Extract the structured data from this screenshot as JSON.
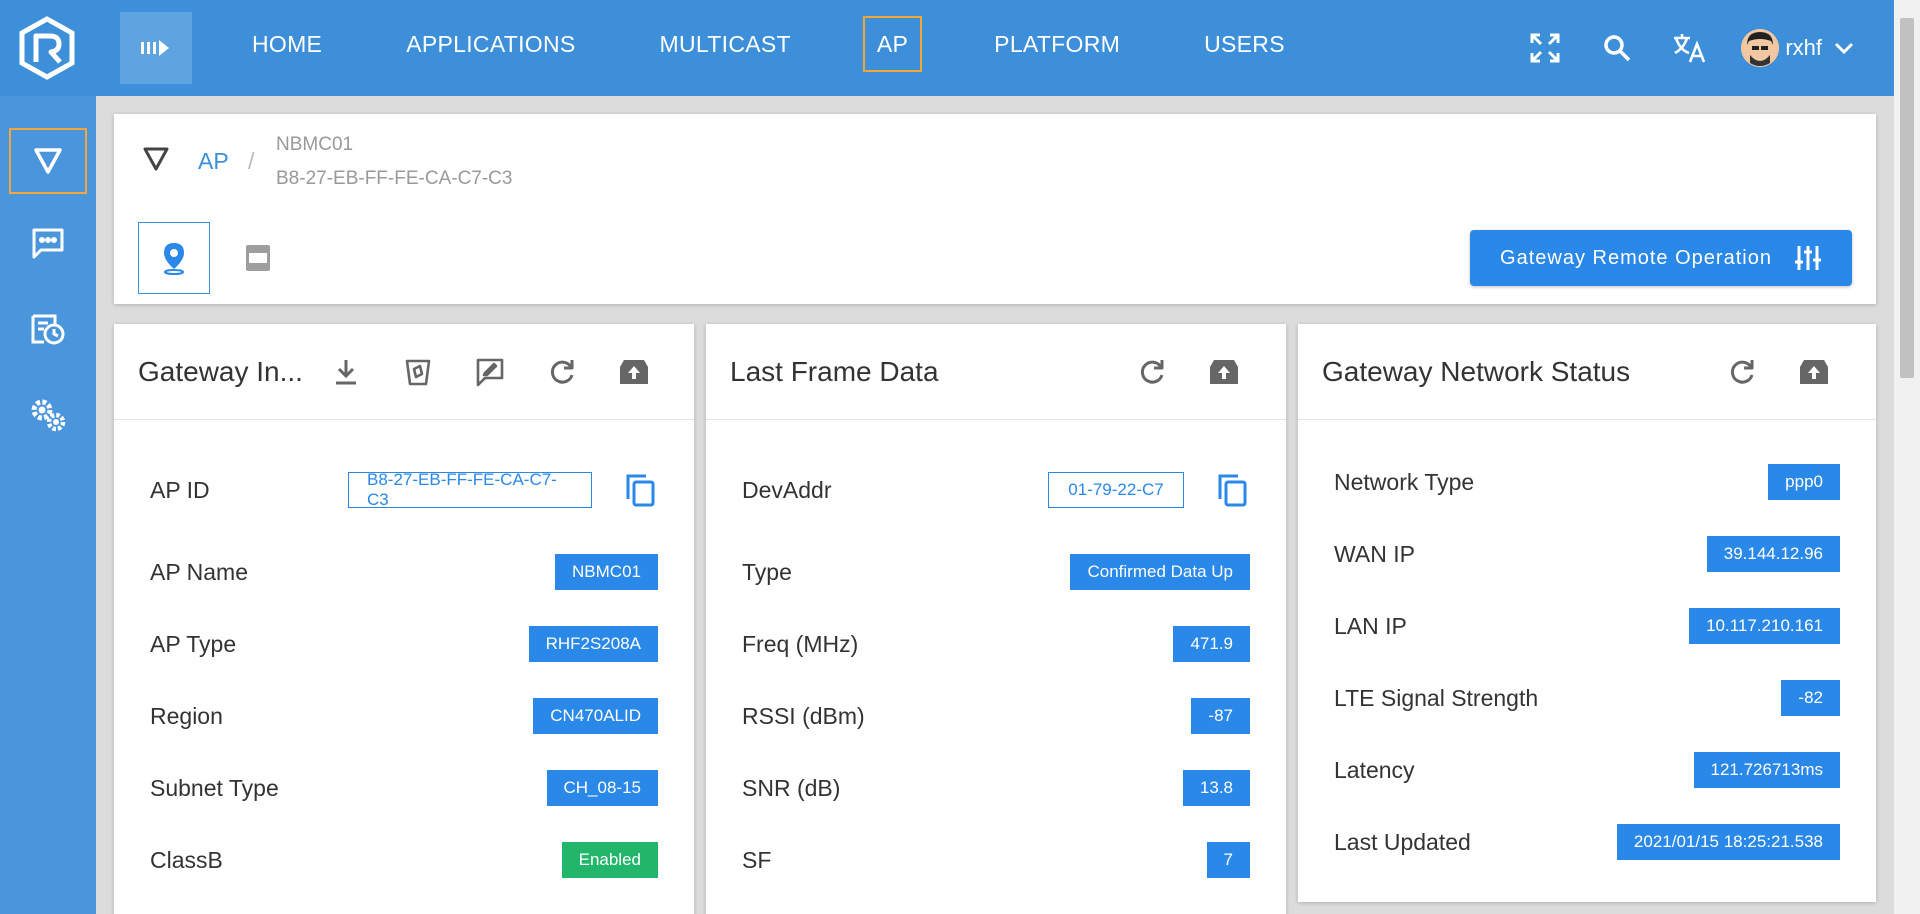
{
  "nav": {
    "items": [
      {
        "label": "HOME"
      },
      {
        "label": "APPLICATIONS"
      },
      {
        "label": "MULTICAST"
      },
      {
        "label": "AP"
      },
      {
        "label": "PLATFORM"
      },
      {
        "label": "USERS"
      }
    ],
    "active": "AP"
  },
  "user": {
    "name": "rxhf"
  },
  "breadcrumb": {
    "root": "AP",
    "separator": "/",
    "name": "NBMC01",
    "id": "B8-27-EB-FF-FE-CA-C7-C3"
  },
  "header": {
    "remote_button_label": "Gateway Remote Operation"
  },
  "gateway_info": {
    "title": "Gateway In...",
    "rows": [
      {
        "label": "AP ID",
        "value": "B8-27-EB-FF-FE-CA-C7-C3"
      },
      {
        "label": "AP Name",
        "value": "NBMC01"
      },
      {
        "label": "AP Type",
        "value": "RHF2S208A"
      },
      {
        "label": "Region",
        "value": "CN470ALID"
      },
      {
        "label": "Subnet Type",
        "value": "CH_08-15"
      },
      {
        "label": "ClassB",
        "value": "Enabled"
      }
    ]
  },
  "last_frame": {
    "title": "Last Frame Data",
    "rows": [
      {
        "label": "DevAddr",
        "value": "01-79-22-C7"
      },
      {
        "label": "Type",
        "value": "Confirmed Data Up"
      },
      {
        "label": "Freq (MHz)",
        "value": "471.9"
      },
      {
        "label": "RSSI (dBm)",
        "value": "-87"
      },
      {
        "label": "SNR (dB)",
        "value": "13.8"
      },
      {
        "label": "SF",
        "value": "7"
      }
    ]
  },
  "network_status": {
    "title": "Gateway Network Status",
    "rows": [
      {
        "label": "Network Type",
        "value": "ppp0"
      },
      {
        "label": "WAN IP",
        "value": "39.144.12.96"
      },
      {
        "label": "LAN IP",
        "value": "10.117.210.161"
      },
      {
        "label": "LTE Signal Strength",
        "value": "-82"
      },
      {
        "label": "Latency",
        "value": "121.726713ms"
      },
      {
        "label": "Last Updated",
        "value": "2021/01/15 18:25:21.538"
      }
    ]
  },
  "colors": {
    "topbar": "#3d8fd9",
    "sidebar": "#4a95db",
    "accent": "#2a88e8",
    "active_outline": "#f3a73a",
    "success": "#21b66a"
  }
}
